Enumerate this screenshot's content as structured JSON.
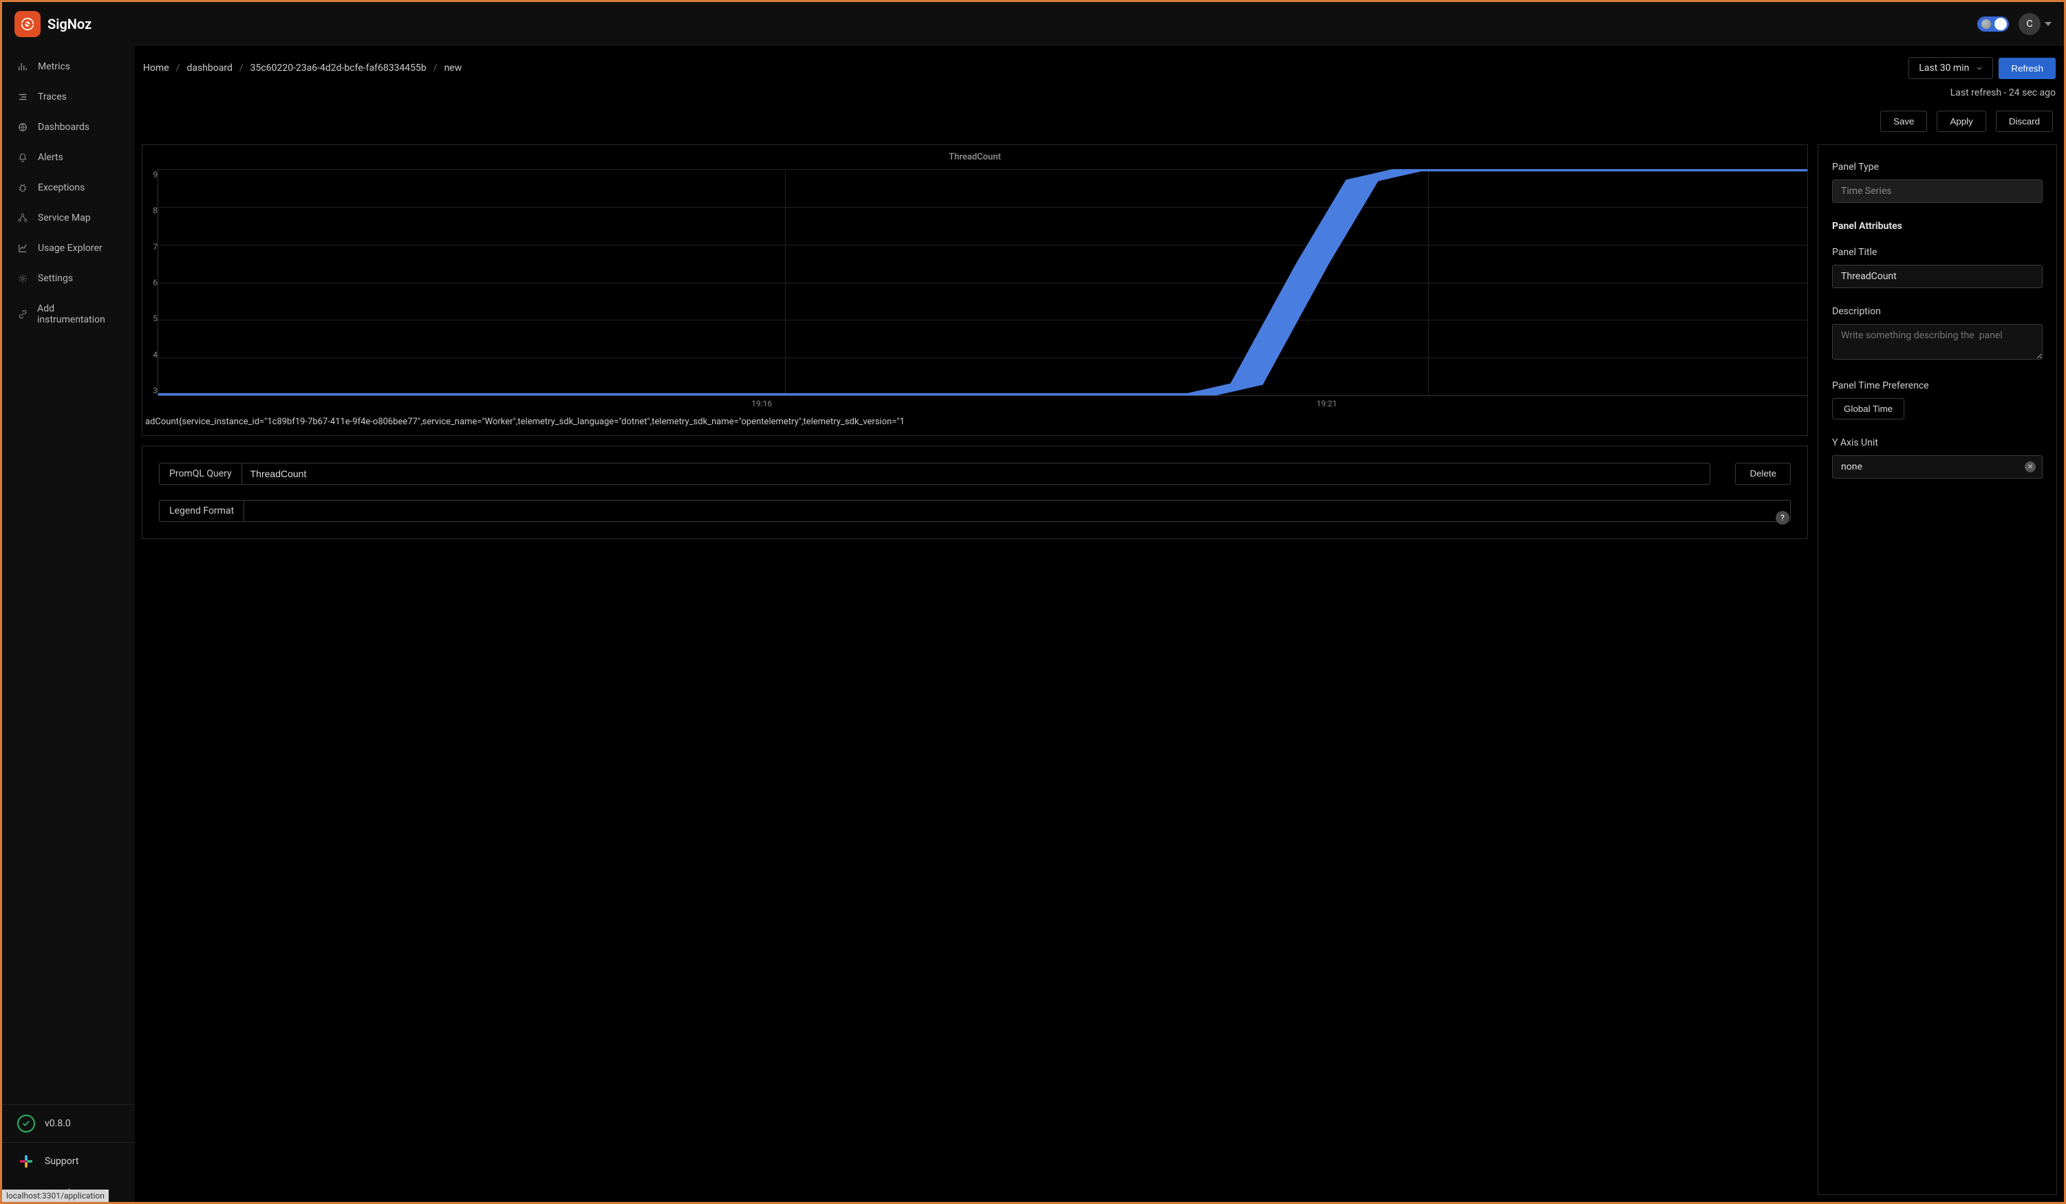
{
  "brand": {
    "name": "SigNoz"
  },
  "avatar_initial": "C",
  "sidebar": {
    "items": [
      {
        "label": "Metrics",
        "icon": "bar-chart-icon"
      },
      {
        "label": "Traces",
        "icon": "list-icon"
      },
      {
        "label": "Dashboards",
        "icon": "globe-icon"
      },
      {
        "label": "Alerts",
        "icon": "bell-icon"
      },
      {
        "label": "Exceptions",
        "icon": "bug-icon"
      },
      {
        "label": "Service Map",
        "icon": "network-icon"
      },
      {
        "label": "Usage Explorer",
        "icon": "line-chart-icon"
      },
      {
        "label": "Settings",
        "icon": "gear-icon"
      },
      {
        "label": "Add instrumentation",
        "icon": "link-icon"
      }
    ],
    "version": "v0.8.0",
    "support": "Support"
  },
  "breadcrumbs": [
    "Home",
    "dashboard",
    "35c60220-23a6-4d2d-bcfe-faf68334455b",
    "new"
  ],
  "time_selector": "Last 30 min",
  "refresh_label": "Refresh",
  "last_refresh": "Last refresh - 24 sec ago",
  "actions": {
    "save": "Save",
    "apply": "Apply",
    "discard": "Discard"
  },
  "chart": {
    "title": "ThreadCount",
    "legend": "adCount{service_instance_id=\"1c89bf19-7b67-411e-9f4e-o806bee77\",service_name=\"Worker\",telemetry_sdk_language=\"dotnet\",telemetry_sdk_name=\"opentelemetry\",telemetry_sdk_version=\"1"
  },
  "chart_data": {
    "type": "line",
    "title": "ThreadCount",
    "ylim": [
      3,
      9
    ],
    "yticks": [
      9,
      8,
      7,
      6,
      5,
      4,
      3
    ],
    "xticks": [
      "19:16",
      "19:21"
    ],
    "x": [
      0,
      0.63,
      0.66,
      0.7,
      0.73,
      0.76,
      1.0
    ],
    "y": [
      3,
      3,
      3.3,
      6.5,
      8.7,
      9,
      9
    ]
  },
  "query": {
    "promql_label": "PromQL Query",
    "promql_value": "ThreadCount",
    "legend_label": "Legend Format",
    "legend_value": "",
    "delete_label": "Delete"
  },
  "right_panel": {
    "panel_type_label": "Panel Type",
    "panel_type_value": "Time Series",
    "panel_attributes_label": "Panel Attributes",
    "panel_title_label": "Panel Title",
    "panel_title_value": "ThreadCount",
    "description_label": "Description",
    "description_placeholder": "Write something describing the  panel",
    "description_value": "",
    "panel_time_pref_label": "Panel Time Preference",
    "global_time_label": "Global Time",
    "y_axis_unit_label": "Y Axis Unit",
    "y_axis_unit_value": "none"
  },
  "status_tooltip": "localhost:3301/application"
}
